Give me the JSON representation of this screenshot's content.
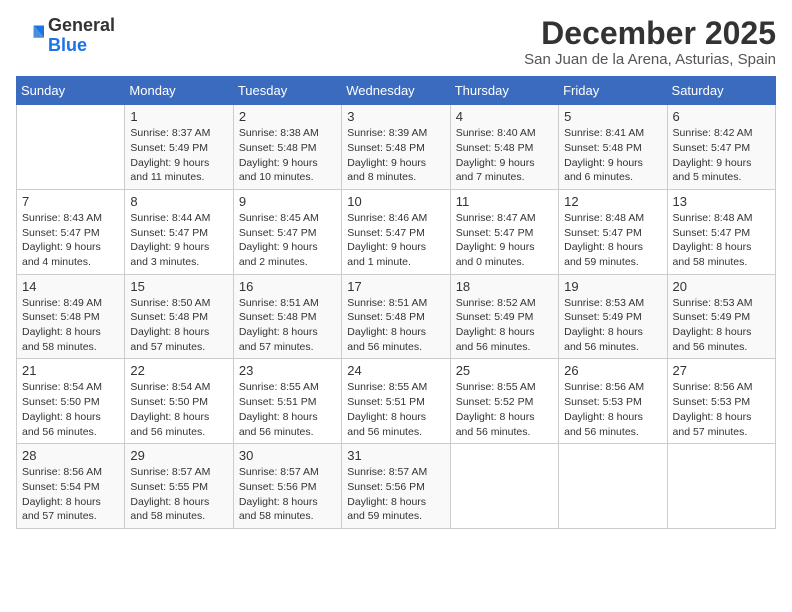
{
  "logo": {
    "general": "General",
    "blue": "Blue"
  },
  "title": "December 2025",
  "location": "San Juan de la Arena, Asturias, Spain",
  "days_of_week": [
    "Sunday",
    "Monday",
    "Tuesday",
    "Wednesday",
    "Thursday",
    "Friday",
    "Saturday"
  ],
  "weeks": [
    [
      {
        "num": "",
        "info": ""
      },
      {
        "num": "1",
        "info": "Sunrise: 8:37 AM\nSunset: 5:49 PM\nDaylight: 9 hours\nand 11 minutes."
      },
      {
        "num": "2",
        "info": "Sunrise: 8:38 AM\nSunset: 5:48 PM\nDaylight: 9 hours\nand 10 minutes."
      },
      {
        "num": "3",
        "info": "Sunrise: 8:39 AM\nSunset: 5:48 PM\nDaylight: 9 hours\nand 8 minutes."
      },
      {
        "num": "4",
        "info": "Sunrise: 8:40 AM\nSunset: 5:48 PM\nDaylight: 9 hours\nand 7 minutes."
      },
      {
        "num": "5",
        "info": "Sunrise: 8:41 AM\nSunset: 5:48 PM\nDaylight: 9 hours\nand 6 minutes."
      },
      {
        "num": "6",
        "info": "Sunrise: 8:42 AM\nSunset: 5:47 PM\nDaylight: 9 hours\nand 5 minutes."
      }
    ],
    [
      {
        "num": "7",
        "info": "Sunrise: 8:43 AM\nSunset: 5:47 PM\nDaylight: 9 hours\nand 4 minutes."
      },
      {
        "num": "8",
        "info": "Sunrise: 8:44 AM\nSunset: 5:47 PM\nDaylight: 9 hours\nand 3 minutes."
      },
      {
        "num": "9",
        "info": "Sunrise: 8:45 AM\nSunset: 5:47 PM\nDaylight: 9 hours\nand 2 minutes."
      },
      {
        "num": "10",
        "info": "Sunrise: 8:46 AM\nSunset: 5:47 PM\nDaylight: 9 hours\nand 1 minute."
      },
      {
        "num": "11",
        "info": "Sunrise: 8:47 AM\nSunset: 5:47 PM\nDaylight: 9 hours\nand 0 minutes."
      },
      {
        "num": "12",
        "info": "Sunrise: 8:48 AM\nSunset: 5:47 PM\nDaylight: 8 hours\nand 59 minutes."
      },
      {
        "num": "13",
        "info": "Sunrise: 8:48 AM\nSunset: 5:47 PM\nDaylight: 8 hours\nand 58 minutes."
      }
    ],
    [
      {
        "num": "14",
        "info": "Sunrise: 8:49 AM\nSunset: 5:48 PM\nDaylight: 8 hours\nand 58 minutes."
      },
      {
        "num": "15",
        "info": "Sunrise: 8:50 AM\nSunset: 5:48 PM\nDaylight: 8 hours\nand 57 minutes."
      },
      {
        "num": "16",
        "info": "Sunrise: 8:51 AM\nSunset: 5:48 PM\nDaylight: 8 hours\nand 57 minutes."
      },
      {
        "num": "17",
        "info": "Sunrise: 8:51 AM\nSunset: 5:48 PM\nDaylight: 8 hours\nand 56 minutes."
      },
      {
        "num": "18",
        "info": "Sunrise: 8:52 AM\nSunset: 5:49 PM\nDaylight: 8 hours\nand 56 minutes."
      },
      {
        "num": "19",
        "info": "Sunrise: 8:53 AM\nSunset: 5:49 PM\nDaylight: 8 hours\nand 56 minutes."
      },
      {
        "num": "20",
        "info": "Sunrise: 8:53 AM\nSunset: 5:49 PM\nDaylight: 8 hours\nand 56 minutes."
      }
    ],
    [
      {
        "num": "21",
        "info": "Sunrise: 8:54 AM\nSunset: 5:50 PM\nDaylight: 8 hours\nand 56 minutes."
      },
      {
        "num": "22",
        "info": "Sunrise: 8:54 AM\nSunset: 5:50 PM\nDaylight: 8 hours\nand 56 minutes."
      },
      {
        "num": "23",
        "info": "Sunrise: 8:55 AM\nSunset: 5:51 PM\nDaylight: 8 hours\nand 56 minutes."
      },
      {
        "num": "24",
        "info": "Sunrise: 8:55 AM\nSunset: 5:51 PM\nDaylight: 8 hours\nand 56 minutes."
      },
      {
        "num": "25",
        "info": "Sunrise: 8:55 AM\nSunset: 5:52 PM\nDaylight: 8 hours\nand 56 minutes."
      },
      {
        "num": "26",
        "info": "Sunrise: 8:56 AM\nSunset: 5:53 PM\nDaylight: 8 hours\nand 56 minutes."
      },
      {
        "num": "27",
        "info": "Sunrise: 8:56 AM\nSunset: 5:53 PM\nDaylight: 8 hours\nand 57 minutes."
      }
    ],
    [
      {
        "num": "28",
        "info": "Sunrise: 8:56 AM\nSunset: 5:54 PM\nDaylight: 8 hours\nand 57 minutes."
      },
      {
        "num": "29",
        "info": "Sunrise: 8:57 AM\nSunset: 5:55 PM\nDaylight: 8 hours\nand 58 minutes."
      },
      {
        "num": "30",
        "info": "Sunrise: 8:57 AM\nSunset: 5:56 PM\nDaylight: 8 hours\nand 58 minutes."
      },
      {
        "num": "31",
        "info": "Sunrise: 8:57 AM\nSunset: 5:56 PM\nDaylight: 8 hours\nand 59 minutes."
      },
      {
        "num": "",
        "info": ""
      },
      {
        "num": "",
        "info": ""
      },
      {
        "num": "",
        "info": ""
      }
    ]
  ]
}
